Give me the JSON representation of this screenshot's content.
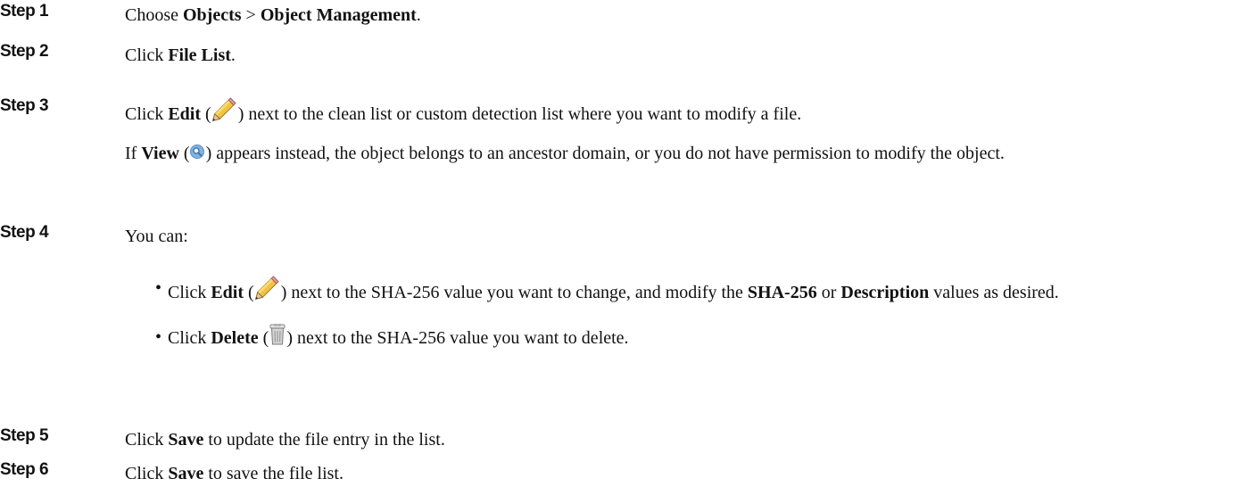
{
  "steps": [
    {
      "label": "Step 1",
      "text_a": "Choose ",
      "bold_a": "Objects",
      "text_b": " > ",
      "bold_b": "Object Management",
      "text_c": "."
    },
    {
      "label": "Step 2",
      "text_a": "Click ",
      "bold_a": "File List",
      "text_b": "."
    },
    {
      "label": "Step 3",
      "text_a": "Click ",
      "bold_a": "Edit",
      "text_b": " (",
      "icon": "pencil-edit-icon",
      "text_c": ") next to the clean list or custom detection list where you want to modify a file.",
      "note_a": "If ",
      "note_bold": "View",
      "note_b": " (",
      "note_icon": "magnifier-view-icon",
      "note_c": ") appears instead, the object belongs to an ancestor domain, or you do not have permission to modify the object."
    },
    {
      "label": "Step 4",
      "intro": "You can:",
      "bullets": [
        {
          "dot": "•",
          "text_a": "Click ",
          "bold_a": "Edit",
          "text_b": " (",
          "icon": "pencil-edit-icon",
          "text_c": ") next to the SHA-256 value you want to change, and modify the ",
          "bold_b": "SHA-256",
          "text_d": " or ",
          "bold_c": "Description",
          "text_e": " values as desired."
        },
        {
          "dot": "•",
          "text_a": "Click ",
          "bold_a": "Delete",
          "text_b": " (",
          "icon": "trash-delete-icon",
          "text_c": ") next to the SHA-256 value you want to delete."
        }
      ]
    },
    {
      "label": "Step 5",
      "text_a": "Click ",
      "bold_a": "Save",
      "text_b": " to update the file entry in the list."
    },
    {
      "label": "Step 6",
      "text_a": "Click ",
      "bold_a": "Save",
      "text_b": " to save the file list."
    }
  ]
}
